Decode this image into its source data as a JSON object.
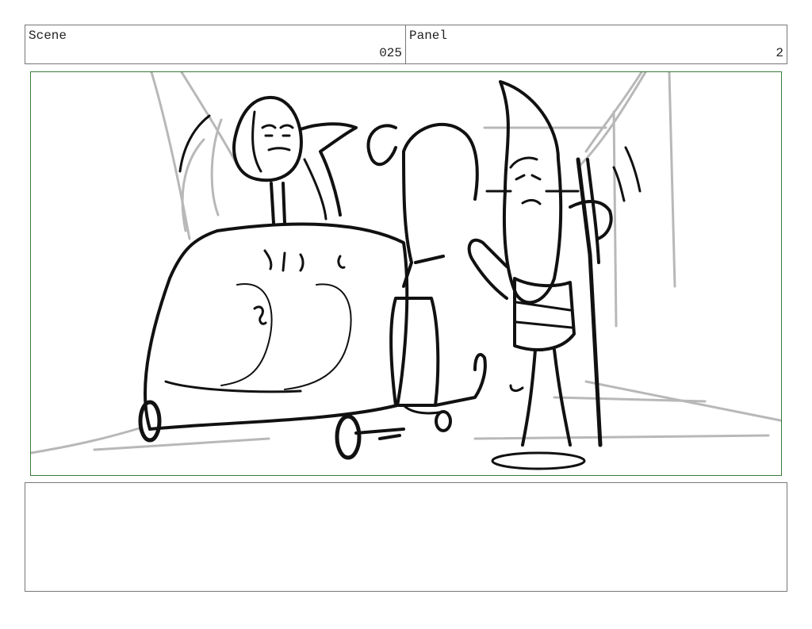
{
  "scene": {
    "label": "Scene",
    "number": "025"
  },
  "panel": {
    "label": "Panel",
    "number": "2"
  },
  "notes": {
    "text": ""
  },
  "colors": {
    "frame_border": "#3a7a3a",
    "box_border": "#777777",
    "ink": "#111111",
    "background_lines": "#b8b8b8"
  }
}
